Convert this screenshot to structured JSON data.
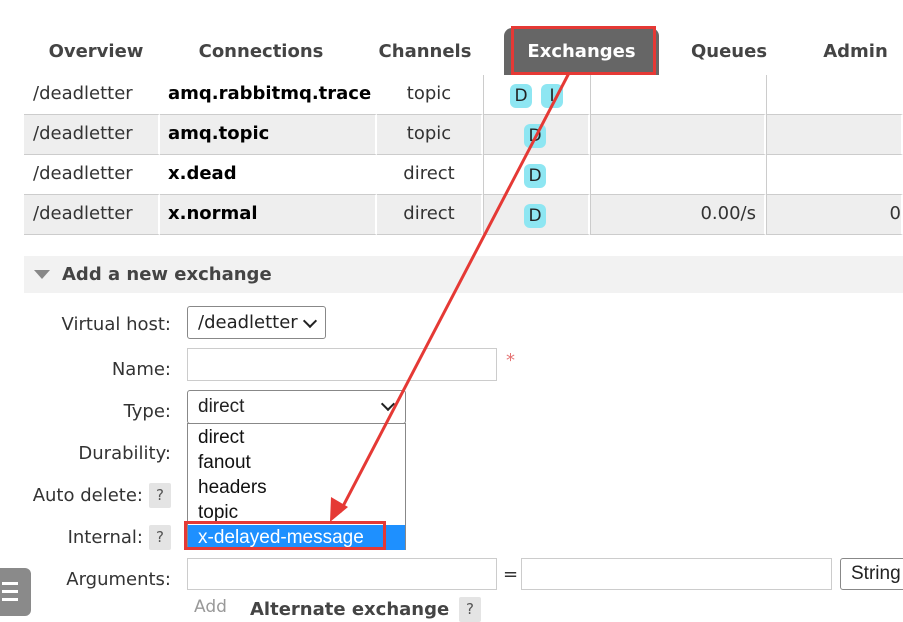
{
  "tabs": [
    {
      "label": "Overview",
      "active": false
    },
    {
      "label": "Connections",
      "active": false
    },
    {
      "label": "Channels",
      "active": false
    },
    {
      "label": "Exchanges",
      "active": true
    },
    {
      "label": "Queues",
      "active": false
    },
    {
      "label": "Admin",
      "active": false
    }
  ],
  "rows": [
    {
      "vhost": "/deadletter",
      "name": "amq.rabbitmq.trace",
      "type": "topic",
      "features": [
        "D",
        "I"
      ],
      "rate_in": "",
      "rate_out": ""
    },
    {
      "vhost": "/deadletter",
      "name": "amq.topic",
      "type": "topic",
      "features": [
        "D"
      ],
      "rate_in": "",
      "rate_out": ""
    },
    {
      "vhost": "/deadletter",
      "name": "x.dead",
      "type": "direct",
      "features": [
        "D"
      ],
      "rate_in": "",
      "rate_out": ""
    },
    {
      "vhost": "/deadletter",
      "name": "x.normal",
      "type": "direct",
      "features": [
        "D"
      ],
      "rate_in": "0.00/s",
      "rate_out": "0"
    }
  ],
  "add_section": {
    "title": "Add a new exchange"
  },
  "form": {
    "virtual_host_label": "Virtual host:",
    "virtual_host_value": "/deadletter",
    "name_label": "Name:",
    "name_value": "",
    "required_mark": "*",
    "type_label": "Type:",
    "type_value": "direct",
    "durability_label": "Durability:",
    "auto_delete_label": "Auto delete:",
    "internal_label": "Internal:",
    "arguments_label": "Arguments:",
    "help": "?",
    "equals": "=",
    "arg_type_value": "String",
    "add_link": "Add",
    "alternate_exchange": "Alternate exchange"
  },
  "type_options": [
    "direct",
    "fanout",
    "headers",
    "topic",
    "x-delayed-message"
  ],
  "type_options_highlighted": "x-delayed-message",
  "colors": {
    "accent_red": "#e53935",
    "tab_active": "#666666",
    "badge": "#8ee6f2",
    "option_selected": "#1e90ff"
  },
  "icons": {
    "menu": "hamburger-menu-icon",
    "collapse": "triangle-down-icon"
  }
}
